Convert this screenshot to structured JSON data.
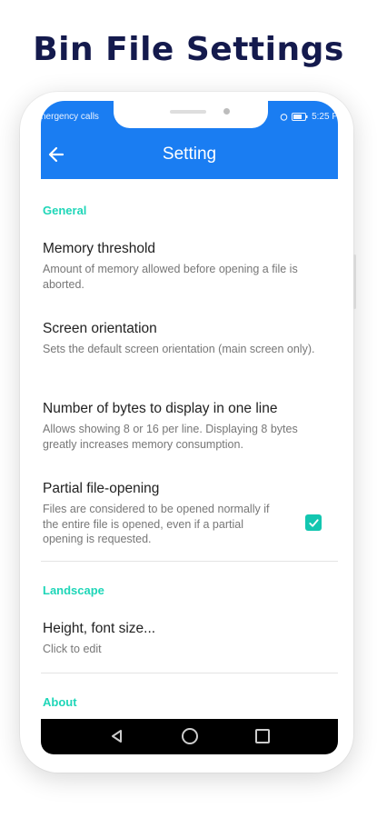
{
  "promo": {
    "title": "Bin File Settings"
  },
  "status_bar": {
    "carrier": "nergency calls",
    "time": "5:25 P"
  },
  "app_bar": {
    "title": "Setting"
  },
  "sections": {
    "general": {
      "header": "General",
      "items": [
        {
          "title": "Memory threshold",
          "summary": "Amount of memory allowed before opening a file is aborted."
        },
        {
          "title": "Screen orientation",
          "summary": "Sets the default screen orientation (main screen only)."
        },
        {
          "title": "Number of bytes to display in one line",
          "summary": "Allows showing 8 or 16 per line. Displaying 8 bytes greatly increases memory consumption."
        },
        {
          "title": "Partial file-opening",
          "summary": "Files are considered to be opened normally if the entire file is opened, even if a partial opening is requested.",
          "checked": true
        }
      ]
    },
    "landscape": {
      "header": "Landscape",
      "items": [
        {
          "title": "Height, font size...",
          "summary": "Click to edit"
        }
      ]
    },
    "about": {
      "header": "About"
    }
  },
  "colors": {
    "app_bar": "#1a7df2",
    "section_header": "#1fd6b8",
    "checkbox": "#13c6b0",
    "promo_title": "#141a4d"
  },
  "icons": {
    "back": "arrow-left-icon",
    "checkbox": "check-icon",
    "nav_back": "triangle-back-icon",
    "nav_home": "circle-home-icon",
    "nav_recents": "square-recents-icon"
  }
}
